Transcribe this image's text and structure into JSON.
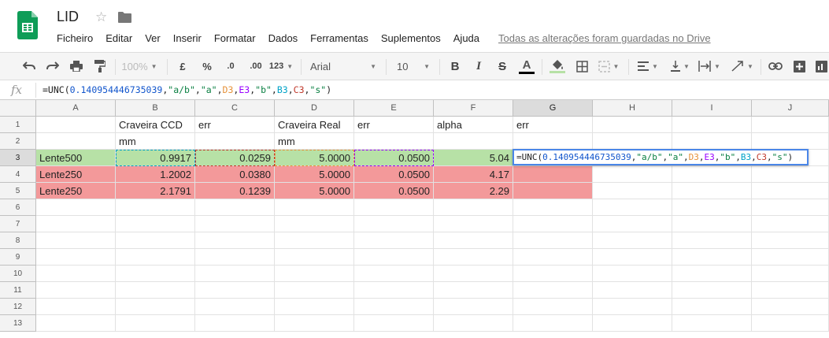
{
  "app": {
    "doc_title": "LID"
  },
  "menu": [
    "Ficheiro",
    "Editar",
    "Ver",
    "Inserir",
    "Formatar",
    "Dados",
    "Ferramentas",
    "Suplementos",
    "Ajuda"
  ],
  "saved_status": "Todas as alterações foram guardadas no Drive",
  "toolbar": {
    "zoom": "100%",
    "currency": "£",
    "percent": "%",
    "dec_less": ".0",
    "dec_more": ".00",
    "more_formats": "123",
    "font": "Arial",
    "font_size": "10",
    "bold": "B",
    "italic": "I",
    "strike": "S",
    "text_color_glyph": "A"
  },
  "formula_bar": {
    "label": "fx",
    "parts": [
      {
        "text": "=UNC(",
        "color": "#222222"
      },
      {
        "text": "0.140954446735039",
        "color": "#1155cc"
      },
      {
        "text": ",",
        "color": "#222222"
      },
      {
        "text": "\"a/b\"",
        "color": "#0b8043"
      },
      {
        "text": ",",
        "color": "#222222"
      },
      {
        "text": "\"a\"",
        "color": "#0b8043"
      },
      {
        "text": ",",
        "color": "#222222"
      },
      {
        "text": "D3",
        "color": "#e69138"
      },
      {
        "text": ",",
        "color": "#222222"
      },
      {
        "text": "E3",
        "color": "#9900ff"
      },
      {
        "text": ",",
        "color": "#222222"
      },
      {
        "text": "\"b\"",
        "color": "#0b8043"
      },
      {
        "text": ",",
        "color": "#222222"
      },
      {
        "text": "B3",
        "color": "#00a2c7"
      },
      {
        "text": ",",
        "color": "#222222"
      },
      {
        "text": "C3",
        "color": "#c0392b"
      },
      {
        "text": ",",
        "color": "#222222"
      },
      {
        "text": "\"s\"",
        "color": "#0b8043"
      },
      {
        "text": ")",
        "color": "#222222"
      }
    ]
  },
  "columns": [
    "A",
    "B",
    "C",
    "D",
    "E",
    "F",
    "G",
    "H",
    "I",
    "J"
  ],
  "rows": [
    "1",
    "2",
    "3",
    "4",
    "5",
    "6",
    "7",
    "8",
    "9",
    "10",
    "11",
    "12",
    "13"
  ],
  "cells": {
    "B1": "Craveira CCD",
    "C1": "err",
    "D1": "Craveira Real",
    "E1": "err",
    "F1": "alpha",
    "G1": "err",
    "B2": "mm",
    "D2": "mm",
    "A3": "Lente500",
    "B3": "0.9917",
    "C3": "0.0259",
    "D3": "5.0000",
    "E3": "0.0500",
    "F3": "5.04",
    "A4": "Lente250",
    "B4": "1.2002",
    "C4": "0.0380",
    "D4": "5.0000",
    "E4": "0.0500",
    "F4": "4.17",
    "A5": "Lente250",
    "B5": "2.1791",
    "C5": "0.1239",
    "D5": "5.0000",
    "E5": "0.0500",
    "F5": "2.29"
  },
  "selected": {
    "cell": "G3",
    "row": "3",
    "col": "G"
  },
  "colors": {
    "row_green": "#b7e1a6",
    "row_red": "#f3999a",
    "selection_blue": "#4a86e8",
    "ref_B3": "#00a2c7",
    "ref_C3": "#c0392b",
    "ref_D3": "#e69138",
    "ref_E3": "#9900ff",
    "brand_green": "#0f9d58"
  }
}
